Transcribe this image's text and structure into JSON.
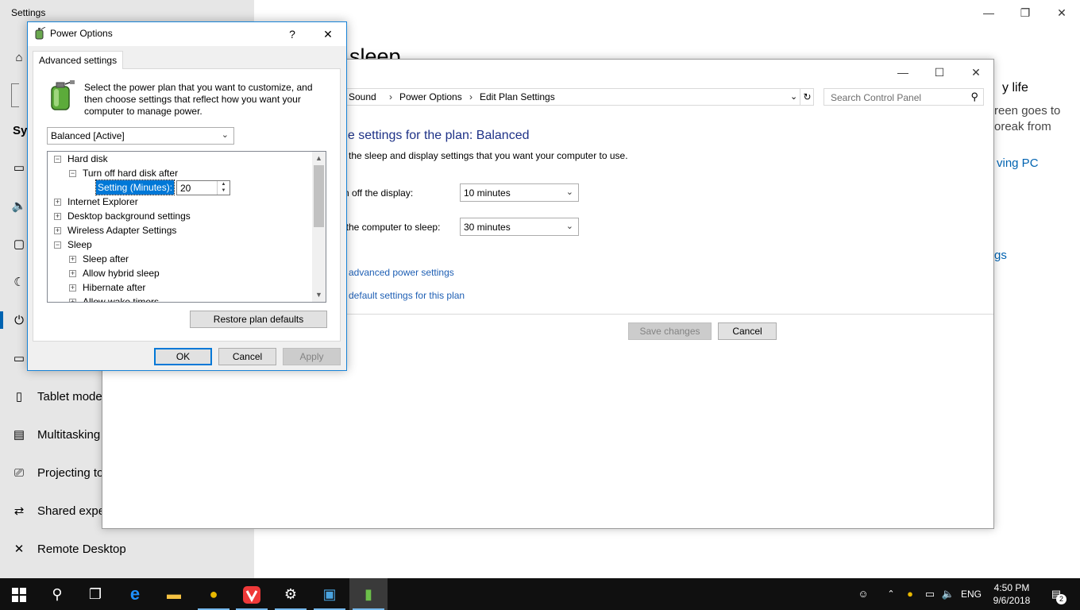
{
  "settings": {
    "title": "Settings",
    "page_heading_fragment": "sleep",
    "sidebar_items": [
      {
        "icon": "home-icon",
        "label": ""
      },
      {
        "icon": "search-box-icon",
        "label": ""
      },
      {
        "icon": "system-label",
        "label": "Sys"
      },
      {
        "icon": "display-icon",
        "label": ""
      },
      {
        "icon": "sound-icon",
        "label": ""
      },
      {
        "icon": "notifications-icon",
        "label": ""
      },
      {
        "icon": "focus-assist-icon",
        "label": ""
      },
      {
        "icon": "power-icon",
        "label": ""
      },
      {
        "icon": "battery-icon",
        "label": ""
      },
      {
        "icon": "tablet-mode-icon",
        "label": "Tablet mode"
      },
      {
        "icon": "multitasking-icon",
        "label": "Multitasking"
      },
      {
        "icon": "projecting-icon",
        "label": "Projecting to"
      },
      {
        "icon": "shared-experiences-icon",
        "label": "Shared expe"
      },
      {
        "icon": "remote-desktop-icon",
        "label": "Remote Desktop"
      }
    ],
    "right_fragments": {
      "battery_life": "y life",
      "screen_goes": "reen goes to",
      "break_from": "oreak from",
      "saving_pc": "ving PC",
      "settings_link": "gs"
    }
  },
  "control_panel": {
    "breadcrumb": [
      "d Sound",
      "Power Options",
      "Edit Plan Settings"
    ],
    "search_placeholder": "Search Control Panel",
    "heading": "ge settings for the plan: Balanced",
    "subline": "e the sleep and display settings that you want your computer to use.",
    "display_label": "rn off the display:",
    "display_value": "10 minutes",
    "sleep_label": "t the computer to sleep:",
    "sleep_value": "30 minutes",
    "advanced_link": "e advanced power settings",
    "restore_link": "e default settings for this plan",
    "save_label": "Save changes",
    "cancel_label": "Cancel"
  },
  "power_options": {
    "title": "Power Options",
    "help": "?",
    "tab": "Advanced settings",
    "description": "Select the power plan that you want to customize, and then choose settings that reflect how you want your computer to manage power.",
    "plan": "Balanced [Active]",
    "tree": {
      "hard_disk": "Hard disk",
      "turn_off": "Turn off hard disk after",
      "setting_label": "Setting (Minutes):",
      "setting_value": "20",
      "internet_explorer": "Internet Explorer",
      "desktop_background": "Desktop background settings",
      "wireless_adapter": "Wireless Adapter Settings",
      "sleep": "Sleep",
      "sleep_after": "Sleep after",
      "hybrid_sleep": "Allow hybrid sleep",
      "hibernate_after": "Hibernate after",
      "wake_timers": "Allow wake timers"
    },
    "restore_button": "Restore plan defaults",
    "ok": "OK",
    "cancel": "Cancel",
    "apply": "Apply"
  },
  "taskbar": {
    "time": "4:50 PM",
    "date": "9/6/2018",
    "language": "ENG",
    "notification_count": "2",
    "apps": [
      "start-icon",
      "search-icon",
      "task-view-icon",
      "edge-icon",
      "file-explorer-icon",
      "antivirus-icon",
      "vivaldi-icon",
      "settings-icon",
      "control-panel-icon",
      "power-options-icon"
    ]
  }
}
